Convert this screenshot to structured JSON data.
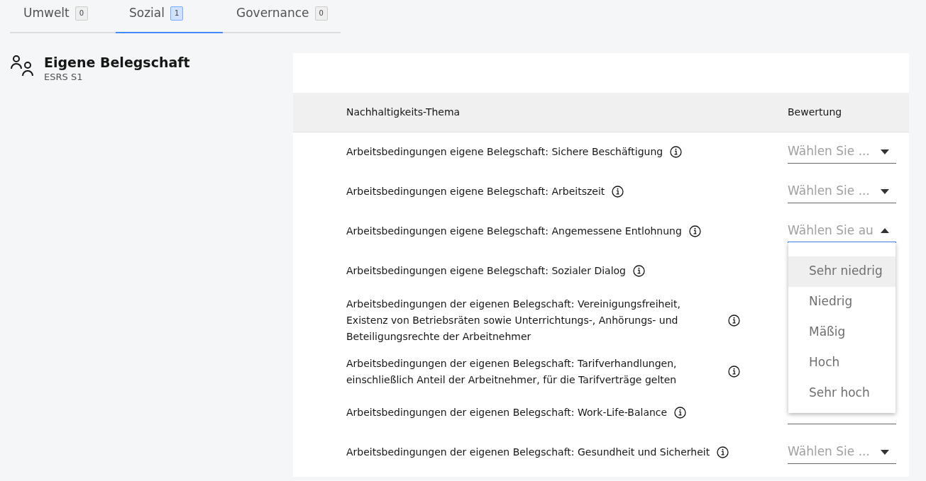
{
  "tabs": [
    {
      "label": "Umwelt",
      "count": "0",
      "selected": false
    },
    {
      "label": "Sozial",
      "count": "1",
      "selected": true
    },
    {
      "label": "Governance",
      "count": "0",
      "selected": false
    }
  ],
  "section": {
    "title": "Eigene Belegschaft",
    "subtitle": "ESRS S1"
  },
  "table": {
    "columns": [
      "Nachhaltigkeits-Thema",
      "Bewertung"
    ],
    "rows": [
      {
        "topic": "Arbeitsbedingungen eigene Belegschaft: Sichere Beschäftigung",
        "select": {
          "placeholder": "Wählen Sie ...",
          "open": false
        }
      },
      {
        "topic": "Arbeitsbedingungen eigene Belegschaft: Arbeitszeit",
        "select": {
          "placeholder": "Wählen Sie ...",
          "open": false
        }
      },
      {
        "topic": "Arbeitsbedingungen eigene Belegschaft: Angemessene Entlohnung",
        "select": {
          "placeholder": "Wählen Sie au",
          "open": true
        }
      },
      {
        "topic": "Arbeitsbedingungen eigene Belegschaft: Sozialer Dialog"
      },
      {
        "topic": "Arbeitsbedingungen der eigenen Belegschaft: Vereinigungsfreiheit, Existenz von Betriebsräten sowie Unterrichtungs-, Anhörungs- und Beteiligungsrechte der Arbeitnehmer"
      },
      {
        "topic": "Arbeitsbedingungen der eigenen Belegschaft: Tarifverhandlungen, einschließlich Anteil der Arbeitnehmer, für die Tarifverträge gelten"
      },
      {
        "topic": "Arbeitsbedingungen der eigenen Belegschaft: Work-Life-Balance",
        "select": {
          "open": false
        }
      },
      {
        "topic": "Arbeitsbedingungen der eigenen Belegschaft: Gesundheit und Sicherheit",
        "select": {
          "placeholder": "Wählen Sie ...",
          "open": false
        }
      }
    ]
  },
  "dropdown": {
    "options": [
      {
        "label": "Sehr niedrig",
        "highlighted": true
      },
      {
        "label": "Niedrig",
        "highlighted": false
      },
      {
        "label": "Mäßig",
        "highlighted": false
      },
      {
        "label": "Hoch",
        "highlighted": false
      },
      {
        "label": "Sehr hoch",
        "highlighted": false
      }
    ]
  }
}
